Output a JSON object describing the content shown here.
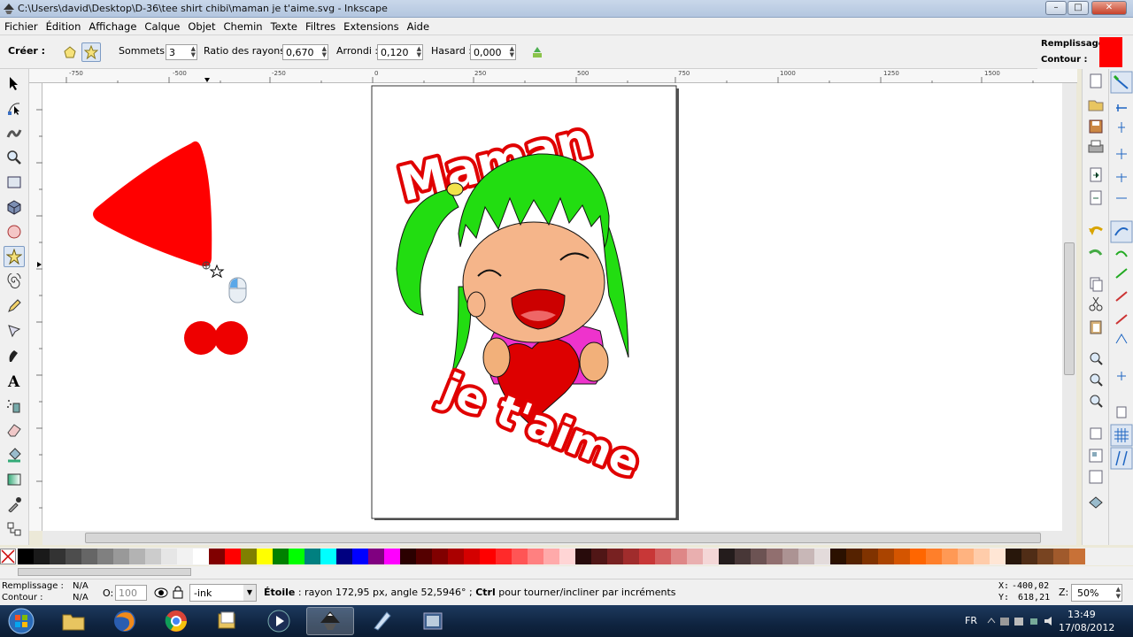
{
  "window": {
    "title": "C:\\Users\\david\\Desktop\\D-36\\tee shirt chibi\\maman je t'aime.svg - Inkscape",
    "minimize": "–",
    "maximize": "□",
    "close": "✕"
  },
  "menu": [
    "Fichier",
    "Édition",
    "Affichage",
    "Calque",
    "Objet",
    "Chemin",
    "Texte",
    "Filtres",
    "Extensions",
    "Aide"
  ],
  "toolctl": {
    "create_label": "Créer :",
    "sommets_label": "Sommets :",
    "sommets_value": "3",
    "ratio_label": "Ratio des rayons :",
    "ratio_value": "0,670",
    "arrondi_label": "Arrondi :",
    "arrondi_value": "0,120",
    "hasard_label": "Hasard :",
    "hasard_value": "0,000",
    "fill_label": "Remplissage :",
    "stroke_label": "Contour :",
    "fill_color": "#ff0000"
  },
  "ruler": {
    "top_ticks": [
      "-750",
      "-500",
      "-250",
      "0",
      "250",
      "500",
      "750",
      "1000",
      "1250",
      "1500"
    ]
  },
  "canvas": {
    "text_top": "Maman",
    "text_bottom": "je t'aime"
  },
  "palette": [
    "#000000",
    "#1a1a1a",
    "#333333",
    "#4d4d4d",
    "#666666",
    "#808080",
    "#999999",
    "#b3b3b3",
    "#cccccc",
    "#e6e6e6",
    "#f2f2f2",
    "#ffffff",
    "#800000",
    "#ff0000",
    "#808000",
    "#ffff00",
    "#008000",
    "#00ff00",
    "#008080",
    "#00ffff",
    "#000080",
    "#0000ff",
    "#800080",
    "#ff00ff",
    "#2b0000",
    "#550000",
    "#800000",
    "#aa0000",
    "#d40000",
    "#ff0000",
    "#ff2a2a",
    "#ff5555",
    "#ff8080",
    "#ffaaaa",
    "#ffd5d5",
    "#280b0b",
    "#501616",
    "#782121",
    "#a02c2c",
    "#c83737",
    "#d35f5f",
    "#de8787",
    "#e9afaf",
    "#f4d7d7",
    "#241c1c",
    "#483737",
    "#6c5353",
    "#916f6f",
    "#ac9393",
    "#c8b7b7",
    "#e3dbdb",
    "#2b1100",
    "#552200",
    "#803300",
    "#aa4400",
    "#d45500",
    "#ff6600",
    "#ff7f2a",
    "#ff9955",
    "#ffb380",
    "#ffccaa",
    "#ffe6d5",
    "#28170b",
    "#502d16",
    "#784421",
    "#a05a2c",
    "#c87137"
  ],
  "status": {
    "fill_label": "Remplissage :",
    "fill_value": "N/A",
    "stroke_label": "Contour :",
    "stroke_value": "N/A",
    "opacity_label": "O:",
    "opacity_value": "100",
    "layer": "-ink",
    "message_bold": "Étoile",
    "message": " : rayon 172,95 px, angle 52,5946° ; ",
    "message_ctrl": "Ctrl",
    "message_tail": " pour tourner/incliner par incréments",
    "x_label": "X:",
    "x_value": "-400,02",
    "y_label": "Y:",
    "y_value": "618,21",
    "zoom_label": "Z:",
    "zoom_value": "50%"
  },
  "taskbar": {
    "lang": "FR",
    "time": "13:49",
    "date": "17/08/2012"
  }
}
